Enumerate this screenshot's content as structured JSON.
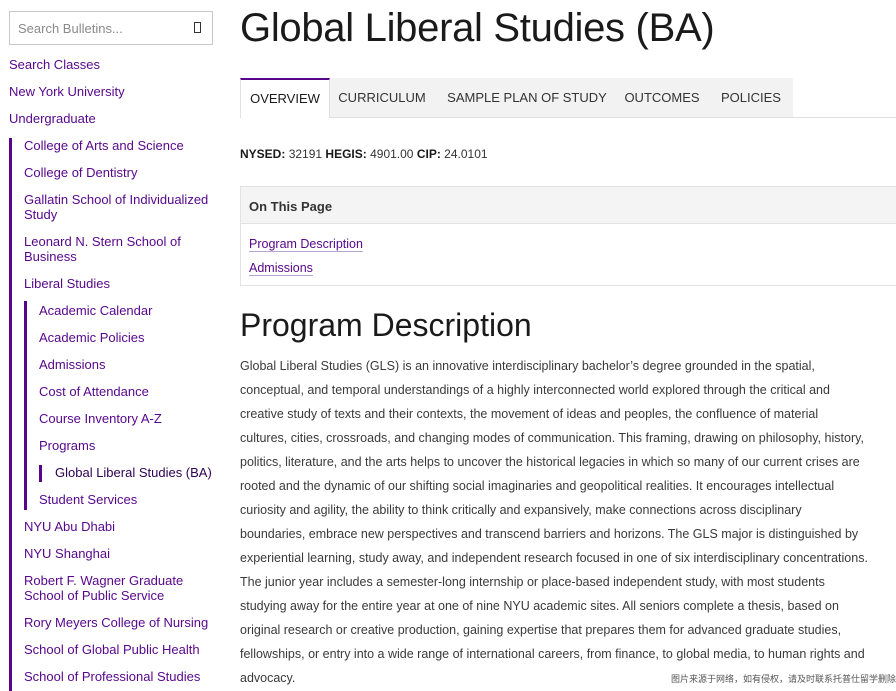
{
  "search": {
    "placeholder": "Search Bulletins..."
  },
  "sidebar": {
    "top_links": [
      "Search Classes",
      "New York University",
      "Undergraduate"
    ],
    "schools": [
      "College of Arts and Science",
      "College of Dentistry",
      "Gallatin School of Individualized Study",
      "Leonard N. Stern School of Business",
      "Liberal Studies",
      "NYU Abu Dhabi",
      "NYU Shanghai",
      "Robert F. Wagner Graduate School of Public Service",
      "Rory Meyers College of Nursing",
      "School of Global Public Health",
      "School of Professional Studies"
    ],
    "liberal_studies_items": [
      "Academic Calendar",
      "Academic Policies",
      "Admissions",
      "Cost of Attendance",
      "Course Inventory A-Z",
      "Programs",
      "Student Services"
    ],
    "current_program": "Global Liberal Studies (BA)"
  },
  "page": {
    "title": "Global Liberal Studies (BA)"
  },
  "tabs": [
    "OVERVIEW",
    "CURRICULUM",
    "SAMPLE PLAN OF STUDY",
    "OUTCOMES",
    "POLICIES"
  ],
  "codes": {
    "nysed_label": "NYSED:",
    "nysed": "32191",
    "hegis_label": "HEGIS:",
    "hegis": "4901.00",
    "cip_label": "CIP:",
    "cip": "24.0101"
  },
  "on_this_page": {
    "title": "On This Page",
    "links": [
      "Program Description",
      "Admissions"
    ]
  },
  "program_description": {
    "heading": "Program Description",
    "body": "Global Liberal Studies (GLS) is an innovative interdisciplinary bachelor’s degree grounded in the spatial,\nconceptual, and temporal understandings of a highly interconnected world explored through the critical and\ncreative study of texts and their contexts, the movement of ideas and peoples, the confluence of material\ncultures, cities, crossroads, and changing modes of communication. This framing, drawing on philosophy, history,\npolitics, literature, and the arts helps to uncover the historical legacies in which so many of our current crises are\nrooted and the dynamic of our shifting social imaginaries and geopolitical realities. It encourages intellectual\ncuriosity and agility, the ability to think critically and expansively, make connections across disciplinary\nboundaries, embrace new perspectives and transcend barriers and horizons. The GLS major is distinguished by\nexperiential learning, study away, and independent research focused in one of six interdisciplinary concentrations.\nThe junior year includes a semester-long internship or place-based independent study, with most students\nstudying away for the entire year at one of nine NYU academic sites. All seniors complete a thesis, based on\noriginal research or creative production, gaining expertise that prepares them for advanced graduate studies,\nfellowships, or entry into a wide range of international careers, from finance, to global media, to human rights and\nadvocacy."
  },
  "watermark": "图片来源于网络，如有侵权，请及时联系托普仕留学删除",
  "colors": {
    "accent": "#57068c",
    "tab_bg": "#f2f2f2"
  }
}
